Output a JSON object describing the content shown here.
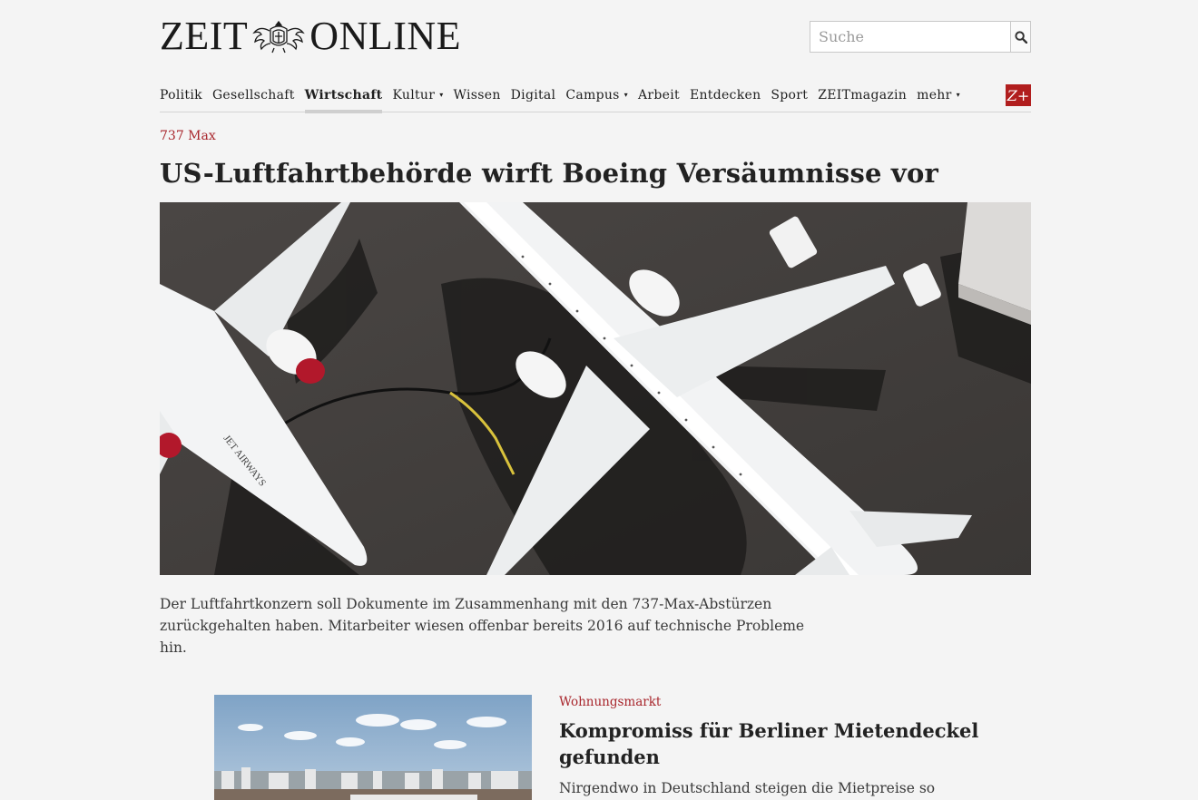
{
  "header": {
    "logo_left": "ZEIT",
    "logo_right": "ONLINE",
    "search_placeholder": "Suche"
  },
  "nav": {
    "items": [
      {
        "label": "Politik",
        "dropdown": false
      },
      {
        "label": "Gesellschaft",
        "dropdown": false
      },
      {
        "label": "Wirtschaft",
        "dropdown": false,
        "active": true
      },
      {
        "label": "Kultur",
        "dropdown": true
      },
      {
        "label": "Wissen",
        "dropdown": false
      },
      {
        "label": "Digital",
        "dropdown": false
      },
      {
        "label": "Campus",
        "dropdown": true
      },
      {
        "label": "Arbeit",
        "dropdown": false
      },
      {
        "label": "Entdecken",
        "dropdown": false
      },
      {
        "label": "Sport",
        "dropdown": false
      },
      {
        "label": "ZEITmagazin",
        "dropdown": false
      },
      {
        "label": "mehr",
        "dropdown": true
      }
    ],
    "zplus_label": "Z+"
  },
  "lead": {
    "kicker": "737 Max",
    "headline": "US-Luftfahrtbehörde wirft Boeing Versäumnisse vor",
    "teaser": "Der Luftfahrtkonzern soll Dokumente im Zusammenhang mit den 737-Max-Abstürzen zurückgehalten haben. Mitarbeiter wiesen offenbar bereits 2016 auf technische Probleme hin.",
    "image_text": "JET AIRWAYS"
  },
  "second": {
    "kicker": "Wohnungsmarkt",
    "headline": "Kompromiss für Berliner Mietendeckel gefunden",
    "teaser": "Nirgendwo in Deutschland steigen die Mietpreise so"
  },
  "colors": {
    "accent_red": "#a8252b",
    "zplus_bg": "#b11e1e",
    "background": "#f4f4f4"
  }
}
